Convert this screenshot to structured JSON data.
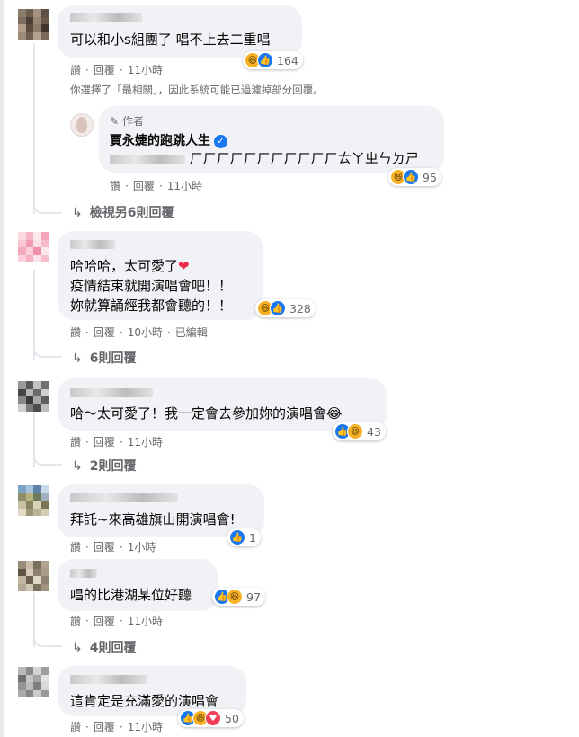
{
  "comments": [
    {
      "text": "可以和小s組團了 唱不上去二重唱",
      "actions": {
        "like": "讚",
        "reply": "回覆",
        "time": "11小時"
      },
      "reaction_count": "164",
      "reaction_icons": [
        "haha-icon",
        "like-icon"
      ]
    },
    {
      "lines": [
        "哈哈哈，太可愛了",
        "疫情結束就開演唱會吧！！",
        "妳就算誦經我都會聽的！！"
      ],
      "emoji_heart": "❤",
      "actions": {
        "like": "讚",
        "reply": "回覆",
        "time": "10小時",
        "edited": "已編輯"
      },
      "reaction_count": "328",
      "reaction_icons": [
        "haha-icon",
        "like-icon"
      ],
      "replies_link": "6則回覆"
    },
    {
      "text": "哈～太可愛了！我一定會去參加妳的演唱會",
      "emoji": "😂",
      "actions": {
        "like": "讚",
        "reply": "回覆",
        "time": "11小時"
      },
      "reaction_count": "43",
      "reaction_icons": [
        "like-icon",
        "haha-icon"
      ],
      "replies_link": "2則回覆"
    },
    {
      "text": "拜託~來高雄旗山開演唱會!",
      "actions": {
        "like": "讚",
        "reply": "回覆",
        "time": "1小時"
      },
      "reaction_count": "1",
      "reaction_icons": [
        "like-icon"
      ]
    },
    {
      "text": "唱的比港湖某位好聽",
      "actions": {
        "like": "讚",
        "reply": "回覆",
        "time": "11小時"
      },
      "reaction_count": "97",
      "reaction_icons": [
        "like-icon",
        "haha-icon"
      ],
      "replies_link": "4則回覆"
    },
    {
      "text": "這肯定是充滿愛的演唱會",
      "actions": {
        "like": "讚",
        "reply": "回覆",
        "time": "11小時"
      },
      "reaction_count": "50",
      "reaction_icons": [
        "like-icon",
        "haha-icon",
        "love-icon"
      ]
    }
  ],
  "filter_note": "你選擇了「最相關」，因此系統可能已過濾掉部分回覆。",
  "author_reply": {
    "badge": "作者",
    "name": "賈永婕的跑跳人生",
    "text": "ㄏㄏㄏㄏㄏㄏㄏㄏㄏㄏㄏㄊㄚㄓㄣㄉㄕ",
    "actions": {
      "like": "讚",
      "reply": "回覆",
      "time": "11小時"
    },
    "reaction_count": "95",
    "reaction_icons": [
      "haha-icon",
      "like-icon"
    ]
  },
  "view_more_replies": "檢視另6則回覆",
  "colors": {
    "like": "#1877f2",
    "haha": "#f7b125",
    "love": "#f33e58",
    "bubble": "#f0f2f5",
    "meta": "#65676b"
  }
}
